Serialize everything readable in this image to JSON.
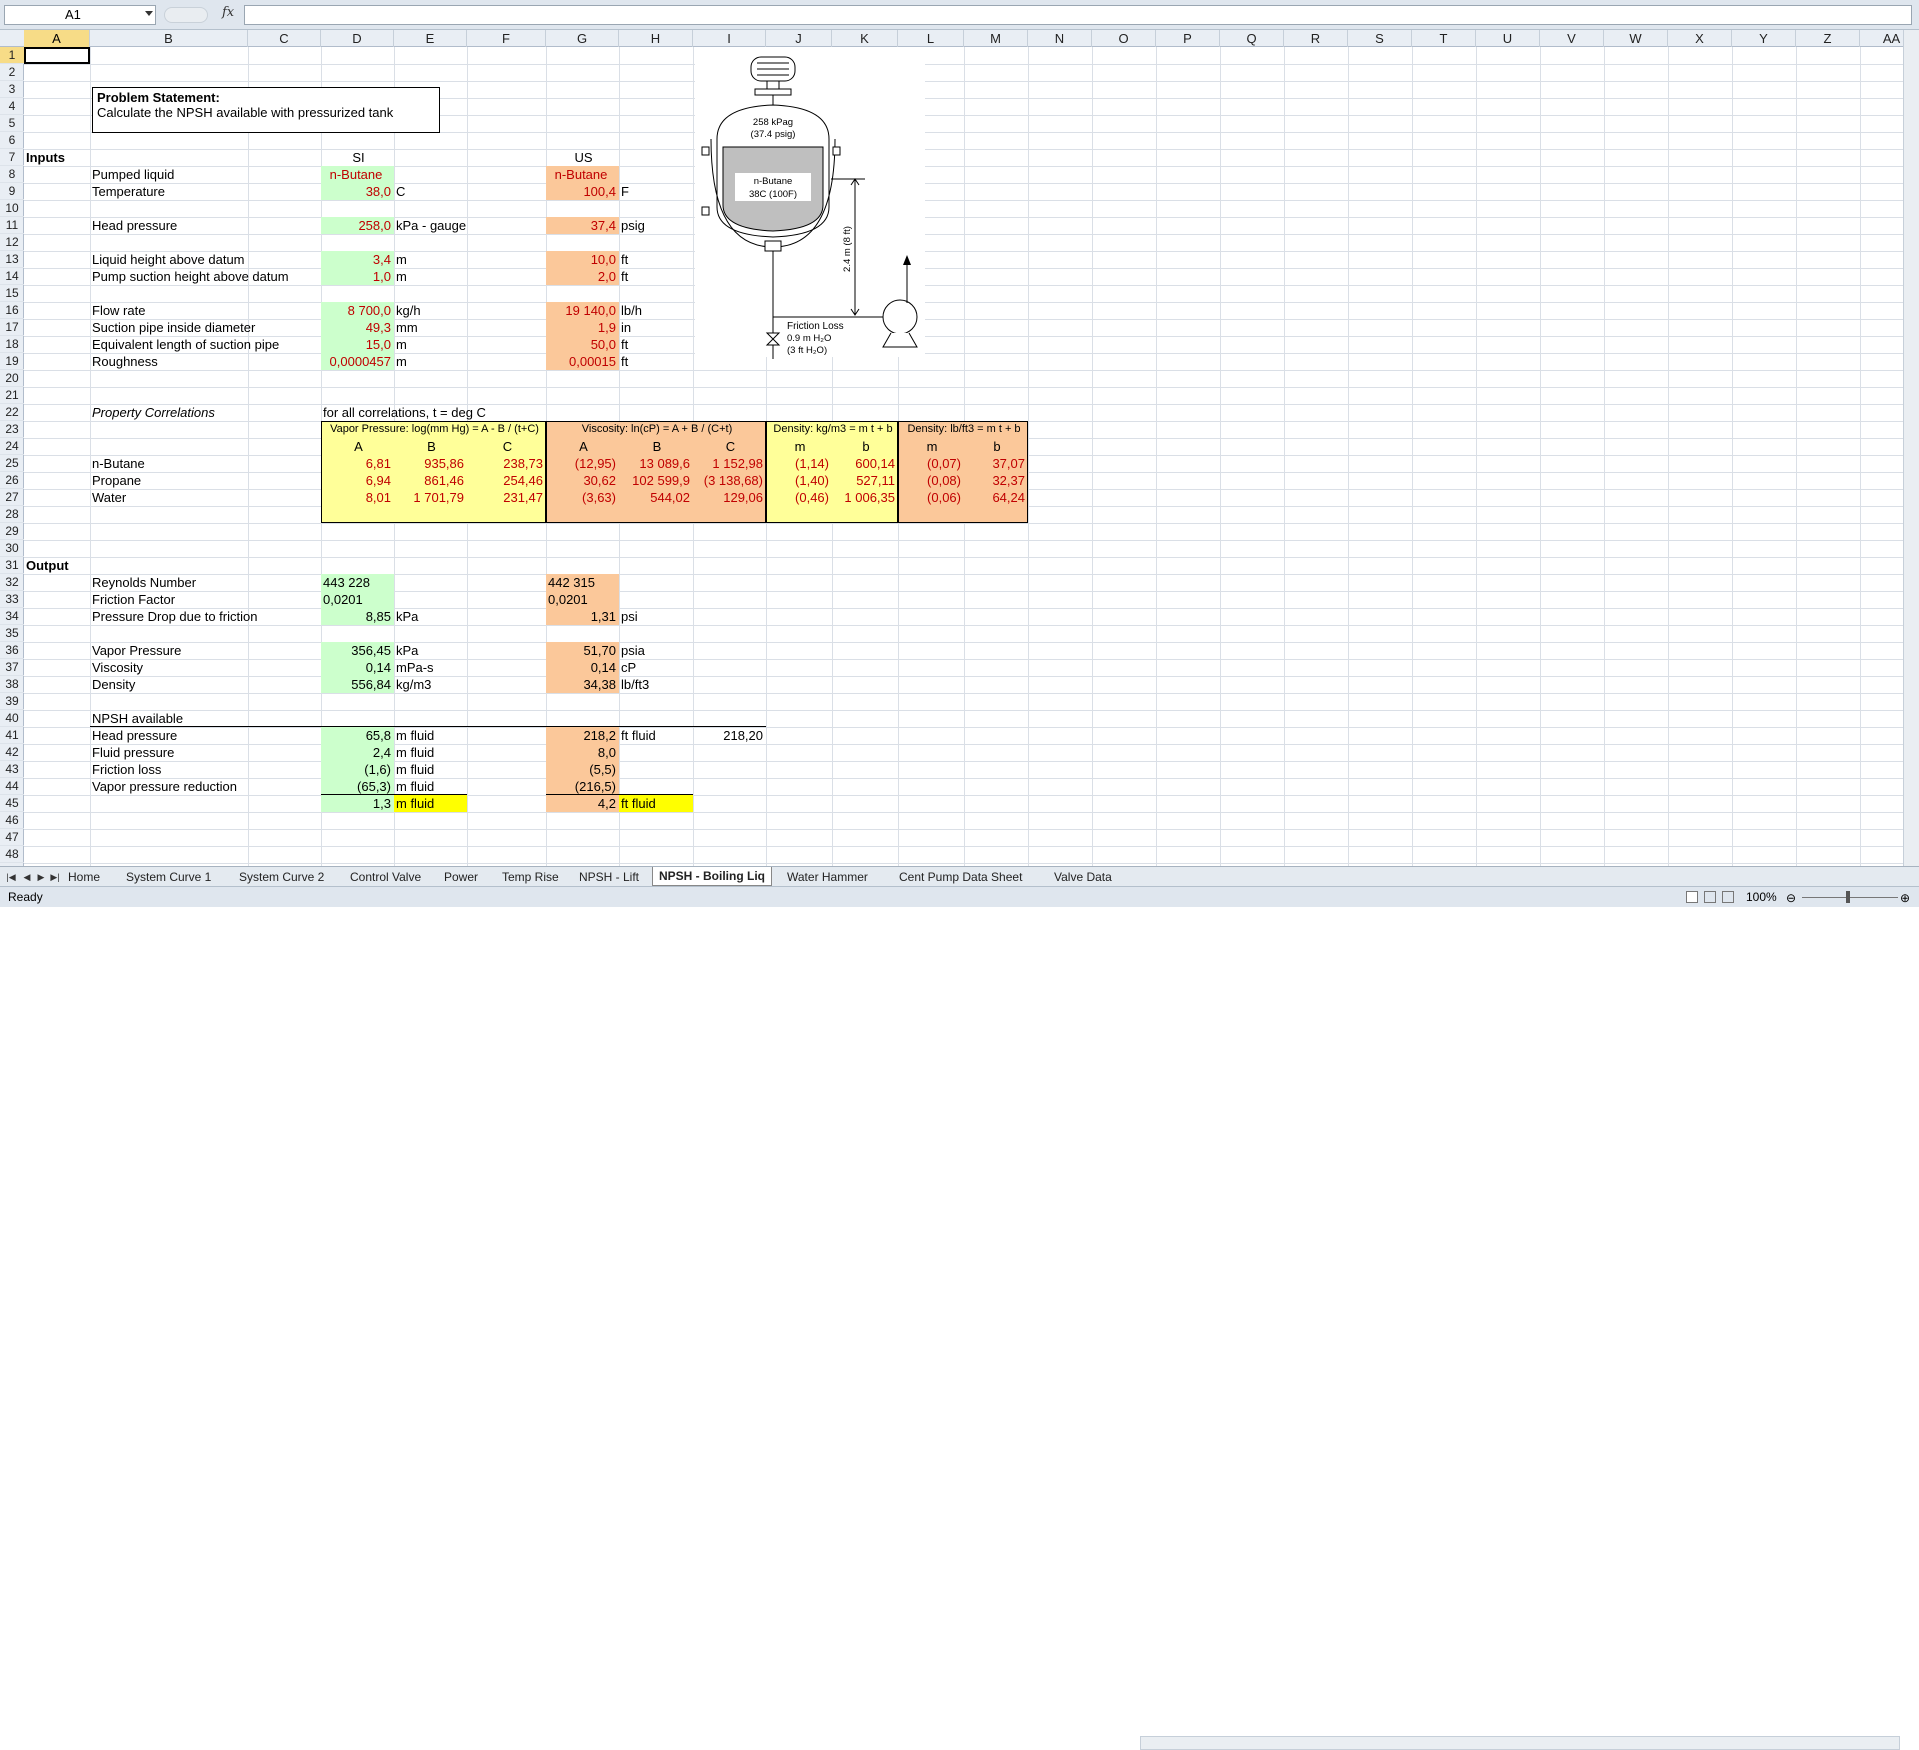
{
  "formula_bar": {
    "name_box": "A1",
    "fx": "fx",
    "formula": ""
  },
  "columns": [
    "A",
    "B",
    "C",
    "D",
    "E",
    "F",
    "G",
    "H",
    "I",
    "J",
    "K",
    "L",
    "M",
    "N",
    "O",
    "P",
    "Q",
    "R",
    "S",
    "T",
    "U",
    "V",
    "W",
    "X",
    "Y",
    "Z",
    "AA"
  ],
  "rows": [
    "1",
    "2",
    "3",
    "4",
    "5",
    "6",
    "7",
    "8",
    "9",
    "10",
    "11",
    "12",
    "13",
    "14",
    "15",
    "16",
    "17",
    "18",
    "19",
    "20",
    "21",
    "22",
    "23",
    "24",
    "25",
    "26",
    "27",
    "28",
    "29",
    "30",
    "31",
    "32",
    "33",
    "34",
    "35",
    "36",
    "37",
    "38",
    "39",
    "40",
    "41",
    "42",
    "43",
    "44",
    "45",
    "46",
    "47",
    "48"
  ],
  "problem": {
    "title": "Problem Statement:",
    "text": "Calculate the NPSH available  with pressurized tank"
  },
  "headers": {
    "inputs": "Inputs",
    "si": "SI",
    "us": "US",
    "output": "Output"
  },
  "inputs": [
    {
      "label": "Pumped liquid",
      "si": "n-Butane",
      "si_unit": "",
      "us": "n-Butane",
      "us_unit": ""
    },
    {
      "label": "Temperature",
      "si": "38,0",
      "si_unit": "C",
      "us": "100,4",
      "us_unit": "F"
    },
    {
      "label": "Head pressure",
      "si": "258,0",
      "si_unit": "kPa - gauge",
      "us": "37,4",
      "us_unit": "psig"
    },
    {
      "label": "Liquid height above datum",
      "si": "3,4",
      "si_unit": "m",
      "us": "10,0",
      "us_unit": "ft"
    },
    {
      "label": "Pump suction height above datum",
      "si": "1,0",
      "si_unit": "m",
      "us": "2,0",
      "us_unit": "ft"
    },
    {
      "label": "Flow rate",
      "si": "8 700,0",
      "si_unit": "kg/h",
      "us": "19 140,0",
      "us_unit": "lb/h"
    },
    {
      "label": "Suction pipe inside diameter",
      "si": "49,3",
      "si_unit": "mm",
      "us": "1,9",
      "us_unit": "in"
    },
    {
      "label": "Equivalent length of suction pipe",
      "si": "15,0",
      "si_unit": "m",
      "us": "50,0",
      "us_unit": "ft"
    },
    {
      "label": "Roughness",
      "si": "0,0000457",
      "si_unit": "m",
      "us": "0,00015",
      "us_unit": "ft"
    }
  ],
  "correlations": {
    "title": "Property Correlations",
    "note": "for all correlations, t = deg C",
    "vp_header": "Vapor Pressure: log(mm Hg) = A - B / (t+C)",
    "visc_header": "Viscosity: ln(cP) = A + B / (C+t)",
    "dens_si_header": "Density: kg/m3 = m t + b",
    "dens_us_header": "Density: lb/ft3 = m t + b",
    "sub": [
      "A",
      "B",
      "C",
      "A",
      "B",
      "C",
      "m",
      "b",
      "m",
      "b"
    ],
    "rows": [
      {
        "name": "n-Butane",
        "vals": [
          "6,81",
          "935,86",
          "238,73",
          "(12,95)",
          "13 089,6",
          "1 152,98",
          "(1,14)",
          "600,14",
          "(0,07)",
          "37,07"
        ]
      },
      {
        "name": "Propane",
        "vals": [
          "6,94",
          "861,46",
          "254,46",
          "30,62",
          "102 599,9",
          "(3 138,68)",
          "(1,40)",
          "527,11",
          "(0,08)",
          "32,37"
        ]
      },
      {
        "name": "Water",
        "vals": [
          "8,01",
          "1 701,79",
          "231,47",
          "(3,63)",
          "544,02",
          "129,06",
          "(0,46)",
          "1 006,35",
          "(0,06)",
          "64,24"
        ]
      }
    ]
  },
  "outputs": [
    {
      "label": "Reynolds Number",
      "si": "443 228",
      "si_unit": "",
      "us": "442 315",
      "us_unit": ""
    },
    {
      "label": "Friction Factor",
      "si": "0,0201",
      "si_unit": "",
      "us": "0,0201",
      "us_unit": ""
    },
    {
      "label": "Pressure Drop due to friction",
      "si": "8,85",
      "si_unit": "kPa",
      "us": "1,31",
      "us_unit": "psi"
    },
    {
      "label": "Vapor Pressure",
      "si": "356,45",
      "si_unit": "kPa",
      "us": "51,70",
      "us_unit": "psia"
    },
    {
      "label": "Viscosity",
      "si": "0,14",
      "si_unit": "mPa-s",
      "us": "0,14",
      "us_unit": "cP"
    },
    {
      "label": "Density",
      "si": "556,84",
      "si_unit": "kg/m3",
      "us": "34,38",
      "us_unit": "lb/ft3"
    }
  ],
  "npsh": {
    "title": "NPSH available",
    "rows": [
      {
        "label": "Head pressure",
        "si": "65,8",
        "si_unit": "m fluid",
        "us": "218,2",
        "us_unit": "ft fluid",
        "extra": "218,20"
      },
      {
        "label": "Fluid pressure",
        "si": "2,4",
        "si_unit": "m fluid",
        "us": "8,0",
        "us_unit": "",
        "extra": ""
      },
      {
        "label": "Friction loss",
        "si": "(1,6)",
        "si_unit": "m fluid",
        "us": "(5,5)",
        "us_unit": "",
        "extra": ""
      },
      {
        "label": "Vapor pressure reduction",
        "si": "(65,3)",
        "si_unit": "m fluid",
        "us": "(216,5)",
        "us_unit": "",
        "extra": ""
      }
    ],
    "total": {
      "si": "1,3",
      "si_unit": "m fluid",
      "us": "4,2",
      "us_unit": "ft fluid"
    }
  },
  "diagram": {
    "pressure_si": "258 kPag",
    "pressure_us": "(37.4 psig)",
    "liquid": "n-Butane",
    "liquid_temp": "38C (100F)",
    "height": "2.4 m (8 ft)",
    "friction_title": "Friction Loss",
    "friction_si": "0.9 m H₂O",
    "friction_us": "(3 ft H₂O)"
  },
  "tabs": [
    "Home",
    "System Curve 1",
    "System Curve 2",
    "Control Valve",
    "Power",
    "Temp Rise",
    "NPSH - Lift",
    "NPSH - Boiling Liq",
    "Water Hammer",
    "Cent Pump Data Sheet",
    "Valve Data"
  ],
  "active_tab": "NPSH - Boiling Liq",
  "status": {
    "ready": "Ready",
    "zoom": "100%"
  }
}
